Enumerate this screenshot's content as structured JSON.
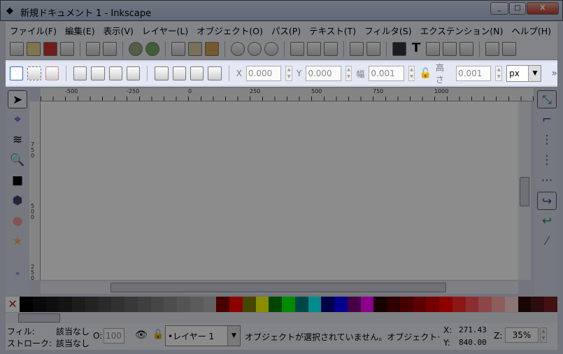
{
  "window": {
    "title": "新規ドキュメント 1 - Inkscape",
    "minimize": "_",
    "maximize": "□",
    "close": "X"
  },
  "menu": [
    "ファイル(F)",
    "編集(E)",
    "表示(V)",
    "レイヤー(L)",
    "オブジェクト(O)",
    "パス(P)",
    "テキスト(T)",
    "フィルタ(S)",
    "エクステンション(N)",
    "ヘルプ(H)"
  ],
  "controls": {
    "x_label": "X",
    "x_value": "0.000",
    "y_label": "Y",
    "y_value": "0.000",
    "w_label": "幅",
    "w_value": "0.001",
    "h_label": "高さ",
    "h_value": "0.001",
    "unit": "px",
    "more": "»"
  },
  "rulers": {
    "h_ticks": [
      "-500",
      "-250",
      "0",
      "250",
      "500",
      "750",
      "1000"
    ],
    "v_ticks": [
      "750",
      "500",
      "250"
    ]
  },
  "palette": [
    "#000000",
    "#111111",
    "#1c1c1c",
    "#262626",
    "#333333",
    "#404040",
    "#4d4d4d",
    "#5a5a5a",
    "#666666",
    "#737373",
    "#808080",
    "#8c8c8c",
    "#999999",
    "#a6a6a6",
    "#b3b3b3",
    "#800000",
    "#ff0000",
    "#808000",
    "#ffff00",
    "#008000",
    "#00ff00",
    "#008080",
    "#00ffff",
    "#000080",
    "#0000ff",
    "#800080",
    "#ff00ff",
    "#2b0000",
    "#550000",
    "#800000",
    "#aa0000",
    "#d40000",
    "#ff0000",
    "#ff2a2a",
    "#ff5555",
    "#ff8080",
    "#ffaaaa",
    "#ffd5d5",
    "#280b0b",
    "#501616",
    "#782121"
  ],
  "status": {
    "fill_label": "フィル:",
    "fill_value": "該当なし",
    "stroke_label": "ストローク:",
    "stroke_value": "該当なし",
    "opacity_label": "O:",
    "opacity_value": "100",
    "layer": "•レイヤー 1",
    "message": "オブジェクトが選択されていません。オブジェクト·",
    "x_label": "X:",
    "x_value": "271.43",
    "y_label": "Y:",
    "y_value": "840.00",
    "zoom_label": "Z:",
    "zoom_value": "35%"
  },
  "toolbox_more": "»"
}
